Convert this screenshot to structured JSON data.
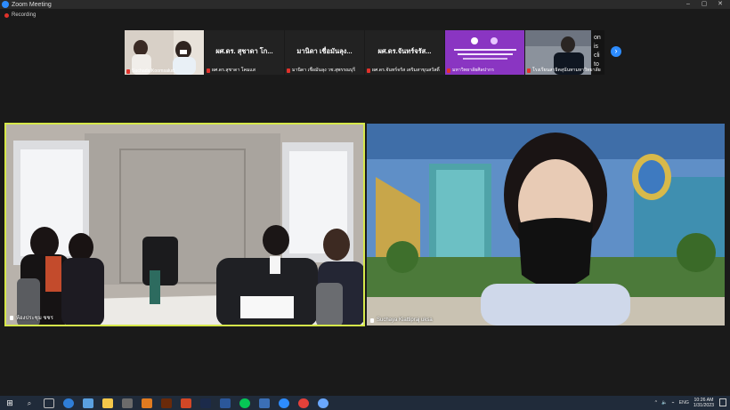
{
  "window": {
    "title": "Zoom Meeting"
  },
  "recording": {
    "label": "Recording"
  },
  "strip": {
    "tiles": [
      {
        "name_big": "",
        "caption": "Suchada Koomsalud"
      },
      {
        "name_big": "ผศ.ดร. สุชาดา โก...",
        "caption": "ผศ.ดร.สุชาดา โคมแส"
      },
      {
        "name_big": "มานิดา เชื่อมันลุง...",
        "caption": "มานิดา เชื่อมันลุง วช.สุพรรณบุรี"
      },
      {
        "name_big": "ผศ.ดร.จันทร์จรัส...",
        "caption": "ผศ.ดร.จันทร์จรัส เตริมสาขุนสวัสดิ์"
      },
      {
        "name_big": "",
        "caption": "มหาวิทยาลัยศิลปากร"
      },
      {
        "name_big": "",
        "caption": "โรงเรียนสาธิตสุนันทามหาวิทยาลัย"
      }
    ],
    "next_label": "›"
  },
  "videos": {
    "left_caption": "ห้องประชุม ชชร",
    "right_caption": "Suchaya Kiattipraj uksa"
  },
  "taskbar": {
    "lang": "ENG",
    "time": "10:26 AM",
    "date": "1/31/2023"
  },
  "colors": {
    "active_speaker_border": "#d6e84a",
    "zoom_blue": "#2d8cff",
    "muted_red": "#e0322b"
  }
}
